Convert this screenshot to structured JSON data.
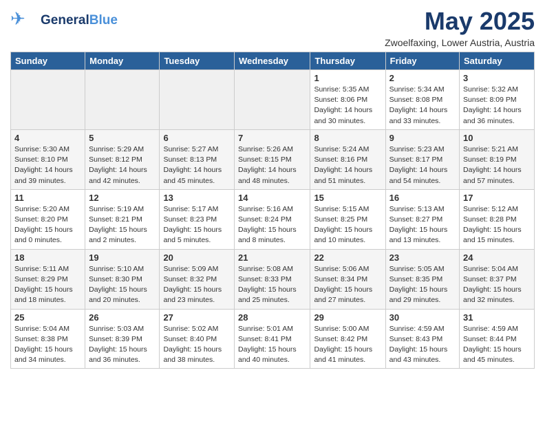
{
  "header": {
    "logo_general": "General",
    "logo_blue": "Blue",
    "month_title": "May 2025",
    "location": "Zwoelfaxing, Lower Austria, Austria"
  },
  "days_of_week": [
    "Sunday",
    "Monday",
    "Tuesday",
    "Wednesday",
    "Thursday",
    "Friday",
    "Saturday"
  ],
  "weeks": [
    [
      {
        "day": "",
        "empty": true
      },
      {
        "day": "",
        "empty": true
      },
      {
        "day": "",
        "empty": true
      },
      {
        "day": "",
        "empty": true
      },
      {
        "day": "1",
        "sunrise": "Sunrise: 5:35 AM",
        "sunset": "Sunset: 8:06 PM",
        "daylight": "Daylight: 14 hours and 30 minutes."
      },
      {
        "day": "2",
        "sunrise": "Sunrise: 5:34 AM",
        "sunset": "Sunset: 8:08 PM",
        "daylight": "Daylight: 14 hours and 33 minutes."
      },
      {
        "day": "3",
        "sunrise": "Sunrise: 5:32 AM",
        "sunset": "Sunset: 8:09 PM",
        "daylight": "Daylight: 14 hours and 36 minutes."
      }
    ],
    [
      {
        "day": "4",
        "sunrise": "Sunrise: 5:30 AM",
        "sunset": "Sunset: 8:10 PM",
        "daylight": "Daylight: 14 hours and 39 minutes."
      },
      {
        "day": "5",
        "sunrise": "Sunrise: 5:29 AM",
        "sunset": "Sunset: 8:12 PM",
        "daylight": "Daylight: 14 hours and 42 minutes."
      },
      {
        "day": "6",
        "sunrise": "Sunrise: 5:27 AM",
        "sunset": "Sunset: 8:13 PM",
        "daylight": "Daylight: 14 hours and 45 minutes."
      },
      {
        "day": "7",
        "sunrise": "Sunrise: 5:26 AM",
        "sunset": "Sunset: 8:15 PM",
        "daylight": "Daylight: 14 hours and 48 minutes."
      },
      {
        "day": "8",
        "sunrise": "Sunrise: 5:24 AM",
        "sunset": "Sunset: 8:16 PM",
        "daylight": "Daylight: 14 hours and 51 minutes."
      },
      {
        "day": "9",
        "sunrise": "Sunrise: 5:23 AM",
        "sunset": "Sunset: 8:17 PM",
        "daylight": "Daylight: 14 hours and 54 minutes."
      },
      {
        "day": "10",
        "sunrise": "Sunrise: 5:21 AM",
        "sunset": "Sunset: 8:19 PM",
        "daylight": "Daylight: 14 hours and 57 minutes."
      }
    ],
    [
      {
        "day": "11",
        "sunrise": "Sunrise: 5:20 AM",
        "sunset": "Sunset: 8:20 PM",
        "daylight": "Daylight: 15 hours and 0 minutes."
      },
      {
        "day": "12",
        "sunrise": "Sunrise: 5:19 AM",
        "sunset": "Sunset: 8:21 PM",
        "daylight": "Daylight: 15 hours and 2 minutes."
      },
      {
        "day": "13",
        "sunrise": "Sunrise: 5:17 AM",
        "sunset": "Sunset: 8:23 PM",
        "daylight": "Daylight: 15 hours and 5 minutes."
      },
      {
        "day": "14",
        "sunrise": "Sunrise: 5:16 AM",
        "sunset": "Sunset: 8:24 PM",
        "daylight": "Daylight: 15 hours and 8 minutes."
      },
      {
        "day": "15",
        "sunrise": "Sunrise: 5:15 AM",
        "sunset": "Sunset: 8:25 PM",
        "daylight": "Daylight: 15 hours and 10 minutes."
      },
      {
        "day": "16",
        "sunrise": "Sunrise: 5:13 AM",
        "sunset": "Sunset: 8:27 PM",
        "daylight": "Daylight: 15 hours and 13 minutes."
      },
      {
        "day": "17",
        "sunrise": "Sunrise: 5:12 AM",
        "sunset": "Sunset: 8:28 PM",
        "daylight": "Daylight: 15 hours and 15 minutes."
      }
    ],
    [
      {
        "day": "18",
        "sunrise": "Sunrise: 5:11 AM",
        "sunset": "Sunset: 8:29 PM",
        "daylight": "Daylight: 15 hours and 18 minutes."
      },
      {
        "day": "19",
        "sunrise": "Sunrise: 5:10 AM",
        "sunset": "Sunset: 8:30 PM",
        "daylight": "Daylight: 15 hours and 20 minutes."
      },
      {
        "day": "20",
        "sunrise": "Sunrise: 5:09 AM",
        "sunset": "Sunset: 8:32 PM",
        "daylight": "Daylight: 15 hours and 23 minutes."
      },
      {
        "day": "21",
        "sunrise": "Sunrise: 5:08 AM",
        "sunset": "Sunset: 8:33 PM",
        "daylight": "Daylight: 15 hours and 25 minutes."
      },
      {
        "day": "22",
        "sunrise": "Sunrise: 5:06 AM",
        "sunset": "Sunset: 8:34 PM",
        "daylight": "Daylight: 15 hours and 27 minutes."
      },
      {
        "day": "23",
        "sunrise": "Sunrise: 5:05 AM",
        "sunset": "Sunset: 8:35 PM",
        "daylight": "Daylight: 15 hours and 29 minutes."
      },
      {
        "day": "24",
        "sunrise": "Sunrise: 5:04 AM",
        "sunset": "Sunset: 8:37 PM",
        "daylight": "Daylight: 15 hours and 32 minutes."
      }
    ],
    [
      {
        "day": "25",
        "sunrise": "Sunrise: 5:04 AM",
        "sunset": "Sunset: 8:38 PM",
        "daylight": "Daylight: 15 hours and 34 minutes."
      },
      {
        "day": "26",
        "sunrise": "Sunrise: 5:03 AM",
        "sunset": "Sunset: 8:39 PM",
        "daylight": "Daylight: 15 hours and 36 minutes."
      },
      {
        "day": "27",
        "sunrise": "Sunrise: 5:02 AM",
        "sunset": "Sunset: 8:40 PM",
        "daylight": "Daylight: 15 hours and 38 minutes."
      },
      {
        "day": "28",
        "sunrise": "Sunrise: 5:01 AM",
        "sunset": "Sunset: 8:41 PM",
        "daylight": "Daylight: 15 hours and 40 minutes."
      },
      {
        "day": "29",
        "sunrise": "Sunrise: 5:00 AM",
        "sunset": "Sunset: 8:42 PM",
        "daylight": "Daylight: 15 hours and 41 minutes."
      },
      {
        "day": "30",
        "sunrise": "Sunrise: 4:59 AM",
        "sunset": "Sunset: 8:43 PM",
        "daylight": "Daylight: 15 hours and 43 minutes."
      },
      {
        "day": "31",
        "sunrise": "Sunrise: 4:59 AM",
        "sunset": "Sunset: 8:44 PM",
        "daylight": "Daylight: 15 hours and 45 minutes."
      }
    ]
  ]
}
